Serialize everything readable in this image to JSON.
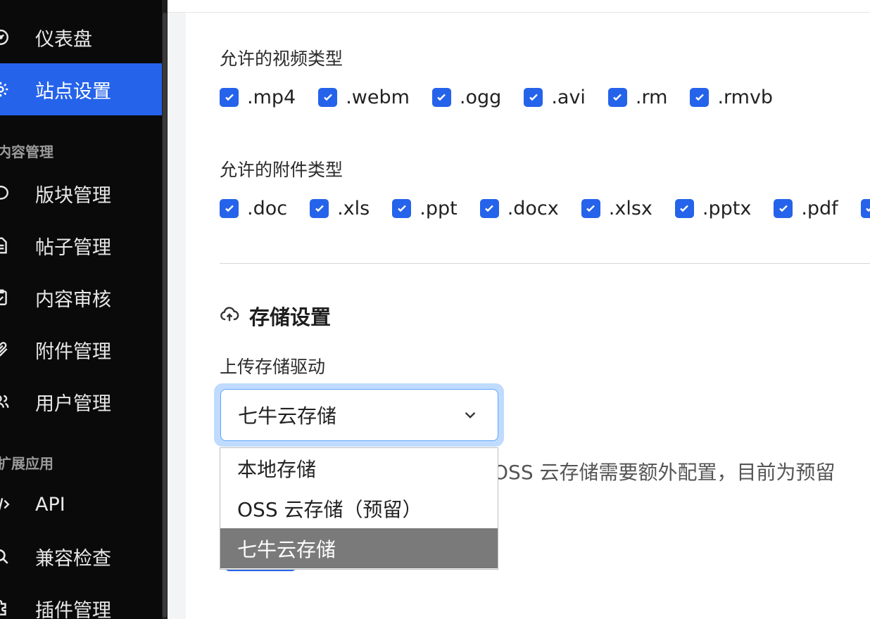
{
  "sidebar": {
    "items": [
      {
        "label": "仪表盘",
        "icon": "dashboard-icon"
      },
      {
        "label": "站点设置",
        "icon": "gear-icon"
      },
      {
        "label": "版块管理",
        "icon": "chat-bubble-icon"
      },
      {
        "label": "帖子管理",
        "icon": "document-icon"
      },
      {
        "label": "内容审核",
        "icon": "clipboard-check-icon"
      },
      {
        "label": "附件管理",
        "icon": "paperclip-icon"
      },
      {
        "label": "用户管理",
        "icon": "users-icon"
      },
      {
        "label": "API",
        "icon": "code-icon"
      },
      {
        "label": "兼容检查",
        "icon": "search-icon"
      },
      {
        "label": "插件管理",
        "icon": "puzzle-icon"
      }
    ],
    "sections": [
      "内容管理",
      "扩展应用"
    ],
    "active_item": "站点设置"
  },
  "settings": {
    "video_types": {
      "label": "允许的视频类型",
      "options": [
        ".mp4",
        ".webm",
        ".ogg",
        ".avi",
        ".rm",
        ".rmvb"
      ]
    },
    "attachment_types": {
      "label": "允许的附件类型",
      "options": [
        ".doc",
        ".xls",
        ".ppt",
        ".docx",
        ".xlsx",
        ".pptx",
        ".pdf"
      ]
    },
    "storage": {
      "title": "存储设置",
      "driver_label": "上传存储驱动",
      "selected": "七牛云存储",
      "options": [
        "本地存储",
        "OSS 云存储（预留）",
        "七牛云存储"
      ],
      "help_text": "OSS 云存储需要额外配置，目前为预留"
    }
  },
  "colors": {
    "accent": "#2563eb",
    "sidebar_bg": "#0a0a0a",
    "selected_option_bg": "#7a7a7a"
  }
}
